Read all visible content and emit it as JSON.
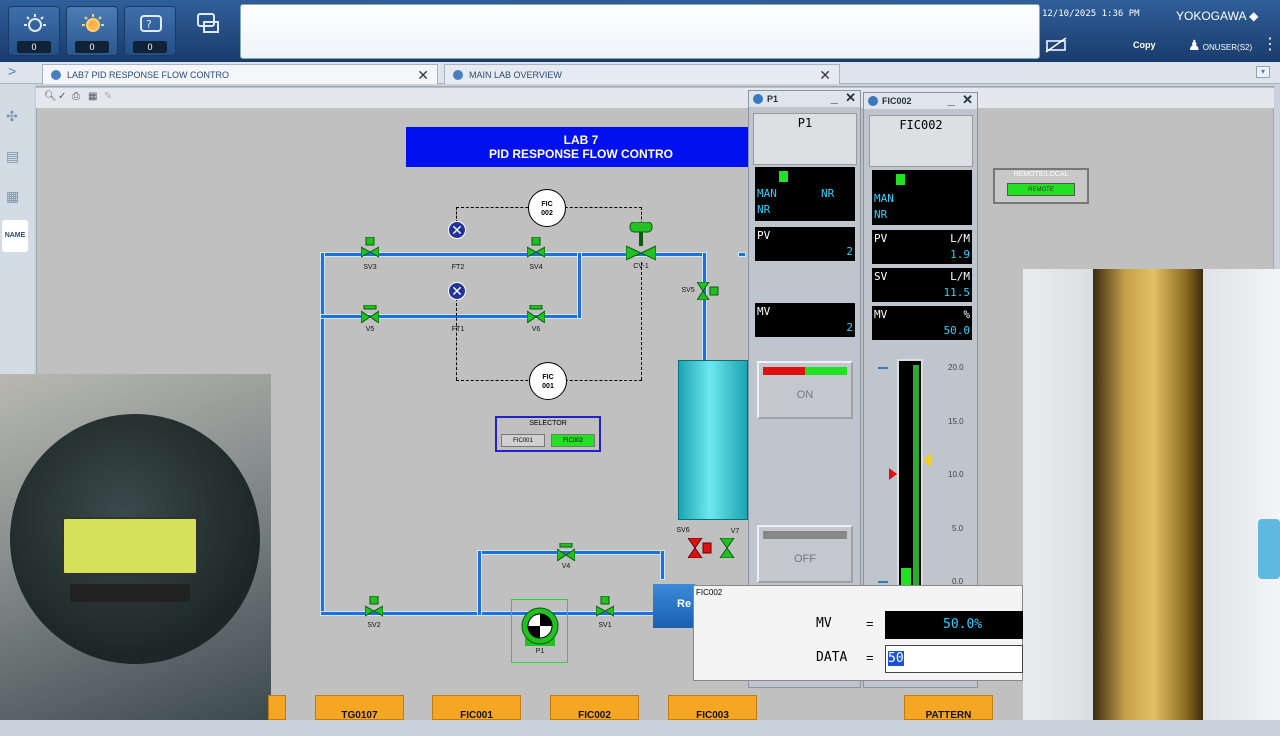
{
  "topbar": {
    "alarm_counts": [
      "0",
      "0",
      "0"
    ],
    "datetime": "12/10/2025 1:36 PM",
    "brand": "YOKOGAWA",
    "copy_label": "Copy",
    "user": "ONUSER(S2)"
  },
  "tabs": [
    {
      "label": "LAB7 PID RESPONSE FLOW CONTRO"
    },
    {
      "label": "MAIN LAB OVERVIEW"
    }
  ],
  "leftbar": {
    "name_label": "NAME"
  },
  "graphic": {
    "title_line1": "LAB 7",
    "title_line2": "PID RESPONSE FLOW CONTRO",
    "fic002": {
      "line1": "FIC",
      "line2": "002"
    },
    "fic001": {
      "line1": "FIC",
      "line2": "001"
    },
    "labels": {
      "sv3": "SV3",
      "ft2": "FT2",
      "sv4": "SV4",
      "cv1": "CV-1",
      "sv5": "SV5",
      "v5": "V5",
      "ft1": "FT1",
      "v6": "V6",
      "sv6": "SV6",
      "v7": "V7",
      "v4": "V4",
      "sv2": "SV2",
      "sv1": "SV1",
      "p1": "P1"
    },
    "selector": {
      "title": "SELECTOR",
      "btn1": "FIC001",
      "btn2": "FIC002"
    },
    "remote_box": {
      "title": "REMOTE/LOCAL",
      "btn": "REMOTE"
    },
    "partial_btn": "Re"
  },
  "faceplate_p1": {
    "window_title": "P1",
    "tag": "P1",
    "mode": "MAN",
    "nr1": "NR",
    "nr2": "NR",
    "pv_label": "PV",
    "pv_value": "2",
    "mv_label": "MV",
    "mv_value": "2",
    "on_label": "ON",
    "off_label": "OFF"
  },
  "faceplate_fic002": {
    "window_title": "FIC002",
    "tag": "FIC002",
    "mode": "MAN",
    "nr": "NR",
    "pv_label": "PV",
    "pv_unit": "L/M",
    "pv_value": "1.9",
    "sv_label": "SV",
    "sv_unit": "L/M",
    "sv_value": "11.5",
    "mv_label": "MV",
    "mv_unit": "%",
    "mv_value": "50.0",
    "scale": [
      "20.0",
      "15.0",
      "10.0",
      "5.0",
      "0.0"
    ],
    "bar_level": 0.09
  },
  "dialog": {
    "title": "FIC002",
    "mv_label": "MV",
    "eq": "=",
    "mv_value": "50.0%",
    "data_label": "DATA",
    "data_value": "50"
  },
  "bottom_buttons": [
    "TG0107",
    "FIC001",
    "FIC002",
    "FIC003",
    "PATTERN"
  ],
  "colors": {
    "title_blue": "#0010ee",
    "pipe": "#1f6fdc",
    "valve_green": "#22c022",
    "dialog_black": "#000000"
  }
}
